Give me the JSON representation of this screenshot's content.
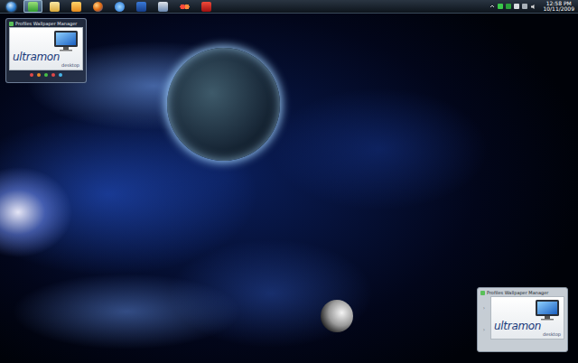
{
  "taskbar": {
    "buttons": [
      {
        "selected": false
      },
      {
        "selected": true
      },
      {
        "selected": false
      },
      {
        "selected": false
      },
      {
        "selected": false
      },
      {
        "selected": false
      },
      {
        "selected": false
      },
      {
        "selected": false
      },
      {
        "selected": false
      },
      {
        "selected": false
      }
    ],
    "tray": {
      "time": "12:58 PM",
      "date": "10/11/2009"
    }
  },
  "gadgets": [
    {
      "kind": "compact",
      "title": "Profiles Wallpaper Manager",
      "logo": {
        "brand": "ultramon",
        "sub": "desktop"
      },
      "dots": [
        {
          "color": "#e04848"
        },
        {
          "color": "#e88a2a"
        },
        {
          "color": "#46c046"
        },
        {
          "color": "#e04848"
        },
        {
          "color": "#46b4e8"
        }
      ],
      "nav": []
    },
    {
      "kind": "list",
      "title": "Profiles Wallpaper Manager",
      "logo": {
        "brand": "ultramon",
        "sub": "desktop"
      },
      "dots": [],
      "nav": [
        "›",
        "›"
      ]
    }
  ]
}
